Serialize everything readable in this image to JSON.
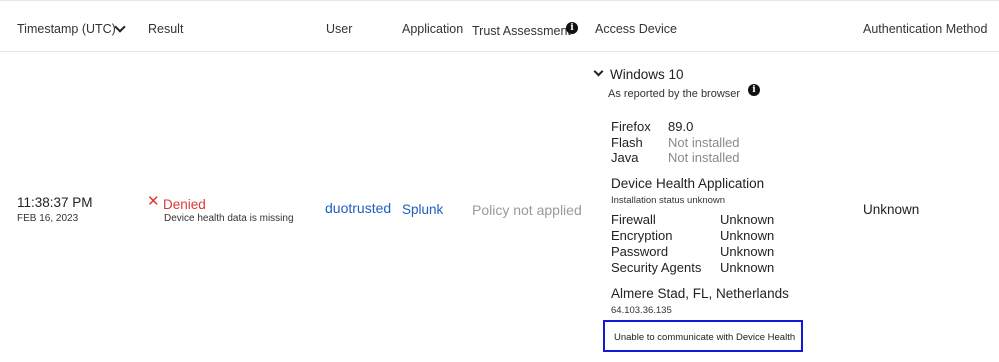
{
  "table": {
    "headers": {
      "timestamp": "Timestamp (UTC)",
      "result": "Result",
      "user": "User",
      "application": "Application",
      "trust_assessment": "Trust Assessment",
      "access_device": "Access Device",
      "auth_method": "Authentication Method"
    },
    "row": {
      "time": "11:38:37 PM",
      "date": "FEB 16, 2023",
      "result": "Denied",
      "result_reason": "Device health data is missing",
      "user": "duotrusted",
      "application": "Splunk",
      "trust_assessment": "Policy not applied",
      "auth_method": "Unknown",
      "access_device": {
        "os": "Windows 10",
        "os_note": "As reported by the browser",
        "browser": [
          {
            "name": "Firefox",
            "value": "89.0"
          },
          {
            "name": "Flash",
            "value": "Not installed"
          },
          {
            "name": "Java",
            "value": "Not installed"
          }
        ],
        "health_app_title": "Device Health Application",
        "health_app_status": "Installation status unknown",
        "security": [
          {
            "name": "Firewall",
            "value": "Unknown"
          },
          {
            "name": "Encryption",
            "value": "Unknown"
          },
          {
            "name": "Password",
            "value": "Unknown"
          },
          {
            "name": "Security Agents",
            "value": "Unknown"
          }
        ],
        "location": "Almere Stad, FL, Netherlands",
        "ip": "64.103.36.135",
        "health_message": "Unable to communicate with Device Health"
      }
    }
  },
  "colors": {
    "denied": "#d93a35",
    "link": "#1f5fbf",
    "muted": "#8a8a8a",
    "highlight": "#1218d8"
  },
  "icons": {
    "sort": "chevron-down-icon",
    "info": "info-icon",
    "denied": "x-icon",
    "expand": "chevron-down-icon"
  }
}
